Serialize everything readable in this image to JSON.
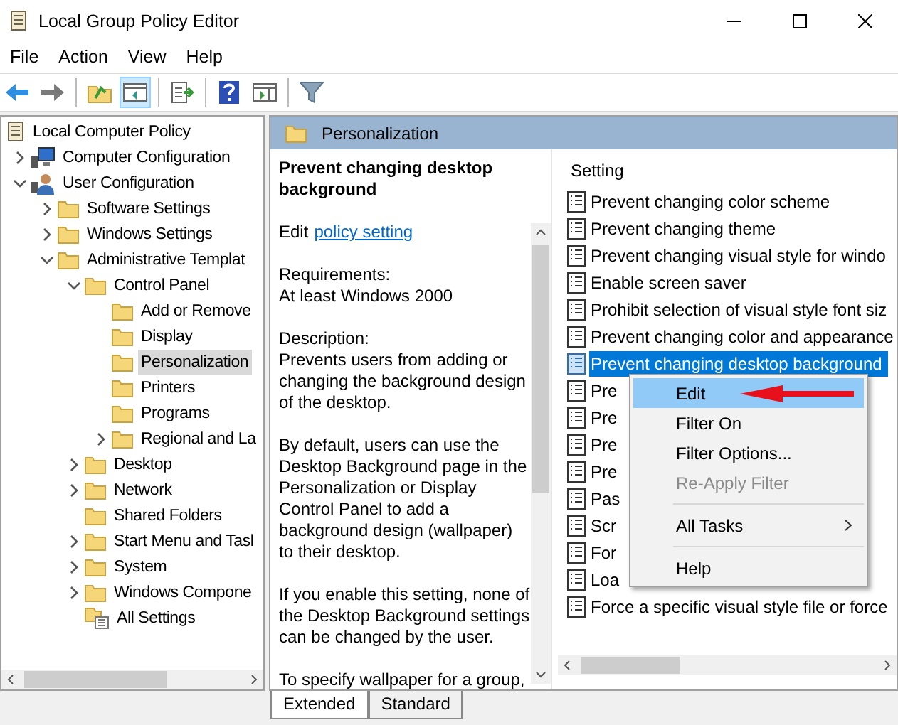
{
  "window": {
    "title": "Local Group Policy Editor"
  },
  "menu": [
    "File",
    "Action",
    "View",
    "Help"
  ],
  "toolbar": [
    {
      "kind": "back",
      "pressed": false
    },
    {
      "kind": "forward",
      "pressed": false
    },
    {
      "kind": "sep"
    },
    {
      "kind": "up",
      "pressed": false
    },
    {
      "kind": "tree",
      "pressed": true
    },
    {
      "kind": "sep"
    },
    {
      "kind": "export",
      "pressed": false
    },
    {
      "kind": "sep"
    },
    {
      "kind": "help",
      "pressed": false
    },
    {
      "kind": "pane",
      "pressed": false
    },
    {
      "kind": "sep"
    },
    {
      "kind": "filter",
      "pressed": false
    }
  ],
  "tree": [
    {
      "label": "Local Computer Policy",
      "kind": "policy",
      "selected": false,
      "children": [
        {
          "label": "Computer Configuration",
          "kind": "computer",
          "expanded": false,
          "selected": false
        },
        {
          "label": "User Configuration",
          "kind": "user",
          "expanded": true,
          "selected": false,
          "children": [
            {
              "label": "Software Settings",
              "kind": "folder",
              "expanded": false,
              "selected": false
            },
            {
              "label": "Windows Settings",
              "kind": "folder",
              "expanded": false,
              "selected": false
            },
            {
              "label": "Administrative Templat",
              "kind": "folder",
              "expanded": true,
              "selected": false,
              "children": [
                {
                  "label": "Control Panel",
                  "kind": "folder",
                  "expanded": true,
                  "selected": false,
                  "children": [
                    {
                      "label": "Add or Remove",
                      "kind": "folder",
                      "selected": false
                    },
                    {
                      "label": "Display",
                      "kind": "folder",
                      "selected": false
                    },
                    {
                      "label": "Personalization",
                      "kind": "folder",
                      "selected": true
                    },
                    {
                      "label": "Printers",
                      "kind": "folder",
                      "selected": false
                    },
                    {
                      "label": "Programs",
                      "kind": "folder",
                      "selected": false
                    },
                    {
                      "label": "Regional and La",
                      "kind": "folder",
                      "expanded": false,
                      "selected": false
                    }
                  ]
                },
                {
                  "label": "Desktop",
                  "kind": "folder",
                  "expanded": false,
                  "selected": false
                },
                {
                  "label": "Network",
                  "kind": "folder",
                  "expanded": false,
                  "selected": false
                },
                {
                  "label": "Shared Folders",
                  "kind": "folder",
                  "selected": false
                },
                {
                  "label": "Start Menu and Tasl",
                  "kind": "folder",
                  "expanded": false,
                  "selected": false
                },
                {
                  "label": "System",
                  "kind": "folder",
                  "expanded": false,
                  "selected": false
                },
                {
                  "label": "Windows Compone",
                  "kind": "folder",
                  "expanded": false,
                  "selected": false
                },
                {
                  "label": "All Settings",
                  "kind": "all-settings",
                  "selected": false
                }
              ]
            }
          ]
        }
      ]
    }
  ],
  "pane_header": "Personalization",
  "description": {
    "title": "Prevent changing desktop background",
    "edit_prefix": "Edit",
    "edit_link": "policy setting",
    "paragraphs": [
      [
        "Requirements:",
        "At least Windows 2000"
      ],
      [
        "Description:",
        "Prevents users from adding or changing the background design of the desktop."
      ],
      [
        "By default, users can use the Desktop Background page in the Personalization or Display Control Panel to add a background design (wallpaper) to their desktop."
      ],
      [
        "If you enable this setting, none of the Desktop Background settings can be changed by the user."
      ],
      [
        "To specify wallpaper for a group,"
      ]
    ]
  },
  "settings": {
    "column": "Setting",
    "rows": [
      {
        "label": "Prevent changing color scheme",
        "selected": false
      },
      {
        "label": "Prevent changing theme",
        "selected": false
      },
      {
        "label": "Prevent changing visual style for windo",
        "selected": false
      },
      {
        "label": "Enable screen saver",
        "selected": false
      },
      {
        "label": "Prohibit selection of visual style font siz",
        "selected": false
      },
      {
        "label": "Prevent changing color and appearance",
        "selected": false
      },
      {
        "label": "Prevent changing desktop background",
        "selected": true
      },
      {
        "label": "Pre",
        "selected": false
      },
      {
        "label": "Pre",
        "selected": false
      },
      {
        "label": "Pre",
        "selected": false
      },
      {
        "label": "Pre",
        "selected": false
      },
      {
        "label": "Pas",
        "selected": false
      },
      {
        "label": "Scr",
        "selected": false
      },
      {
        "label": "For",
        "selected": false
      },
      {
        "label": "Loa",
        "selected": false
      },
      {
        "label": "Force a specific visual style file or force",
        "selected": false
      }
    ]
  },
  "context_menu": [
    {
      "kind": "item",
      "label": "Edit",
      "selected": true,
      "disabled": false
    },
    {
      "kind": "item",
      "label": "Filter On",
      "selected": false,
      "disabled": false
    },
    {
      "kind": "item",
      "label": "Filter Options...",
      "selected": false,
      "disabled": false
    },
    {
      "kind": "item",
      "label": "Re-Apply Filter",
      "selected": false,
      "disabled": true
    },
    {
      "kind": "separator"
    },
    {
      "kind": "submenu",
      "label": "All Tasks",
      "selected": false,
      "disabled": false
    },
    {
      "kind": "separator"
    },
    {
      "kind": "item",
      "label": "Help",
      "selected": false,
      "disabled": false
    }
  ],
  "tabs": [
    {
      "label": "Extended",
      "selected": true
    },
    {
      "label": "Standard",
      "selected": false
    }
  ]
}
